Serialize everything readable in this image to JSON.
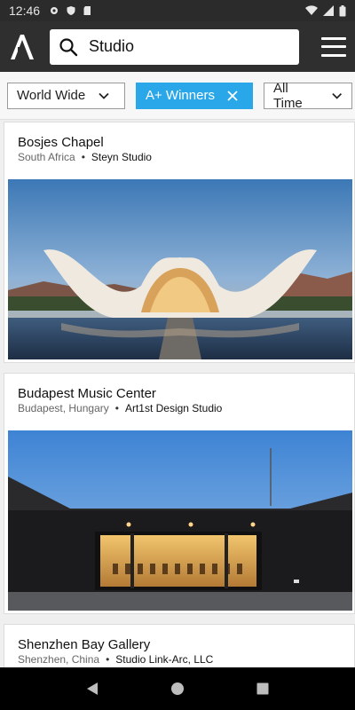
{
  "status_bar": {
    "time": "12:46"
  },
  "search": {
    "value": "Studio"
  },
  "filters": {
    "region": "World Wide",
    "winners": "A+ Winners",
    "period": "All Time"
  },
  "projects": [
    {
      "title": "Bosjes Chapel",
      "location": "South Africa",
      "studio": "Steyn Studio"
    },
    {
      "title": "Budapest Music Center",
      "location": "Budapest, Hungary",
      "studio": "Art1st Design Studio"
    },
    {
      "title": "Shenzhen Bay Gallery",
      "location": "Shenzhen, China",
      "studio": "Studio Link-Arc, LLC"
    }
  ],
  "colors": {
    "accent": "#29a7e8",
    "app_bar": "#2f2f2f",
    "status_bar": "#2b2b2b"
  }
}
